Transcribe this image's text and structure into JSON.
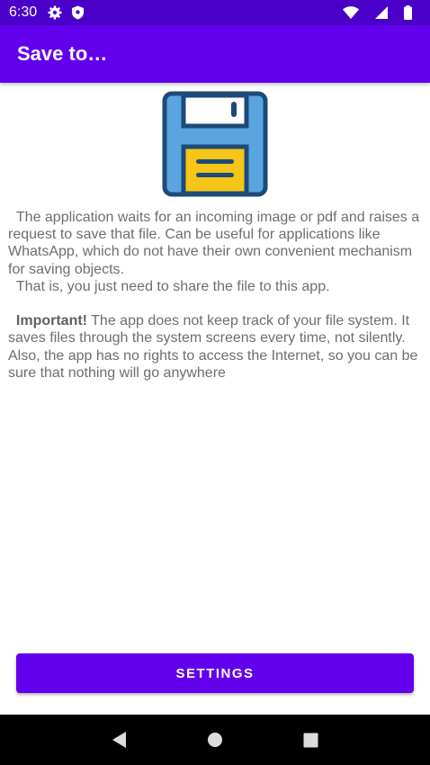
{
  "status_bar": {
    "time": "6:30",
    "icons_left": [
      "gear-icon",
      "shield-icon"
    ],
    "icons_right": [
      "wifi-icon",
      "signal-icon",
      "battery-icon"
    ]
  },
  "app_bar": {
    "title": "Save to…",
    "color": "#6200ee"
  },
  "main": {
    "illustration": "floppy-disk-icon",
    "paragraph1_line1": "  The application waits for an incoming image or pdf and raises a request to save that file. Can be useful for applications like WhatsApp, which do not have their own convenient mechanism for saving objects.",
    "paragraph1_line2": "  That is, you just need to share the file to this app.",
    "important_label": "Important!",
    "important_text": " The app does not keep track of your file system. It saves files through the system screens every time, not silently. Also, the app has no rights to access the Internet, so you can be sure that nothing will go anywhere"
  },
  "settings_button": {
    "label": "SETTINGS"
  },
  "nav_bar": {
    "buttons": [
      "back-icon",
      "home-icon",
      "recents-icon"
    ]
  }
}
